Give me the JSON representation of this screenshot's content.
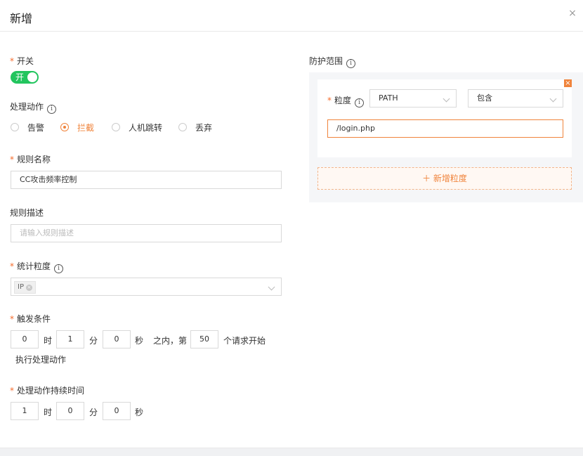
{
  "dialog": {
    "title": "新增",
    "close_glyph": "×"
  },
  "left": {
    "switch": {
      "label": "开关",
      "state_text": "开"
    },
    "action": {
      "label": "处理动作",
      "options": [
        "告警",
        "拦截",
        "人机跳转",
        "丢弃"
      ],
      "selected": "拦截"
    },
    "rule_name": {
      "label": "规则名称",
      "value": "CC攻击频率控制"
    },
    "rule_desc": {
      "label": "规则描述",
      "placeholder": "请输入规则描述"
    },
    "granularity": {
      "label": "统计粒度",
      "tag": "IP"
    },
    "trigger": {
      "label": "触发条件",
      "hours": "0",
      "hour_unit": "时",
      "minutes": "1",
      "minute_unit": "分",
      "seconds": "0",
      "second_unit": "秒",
      "within_text": "之内，第",
      "count": "50",
      "tail_text": "个请求开始",
      "second_line": "执行处理动作"
    },
    "duration": {
      "label": "处理动作持续时间",
      "hours": "1",
      "hour_unit": "时",
      "minutes": "0",
      "minute_unit": "分",
      "seconds": "0",
      "second_unit": "秒"
    }
  },
  "right": {
    "scope_label": "防护范围",
    "item": {
      "label": "粒度",
      "type_value": "PATH",
      "op_value": "包含",
      "path_value": "/login.php"
    },
    "add_button": "＋ 新增粒度"
  },
  "colors": {
    "accent": "#f0843c",
    "switch_on": "#22c55e",
    "required": "#f56c2d"
  }
}
